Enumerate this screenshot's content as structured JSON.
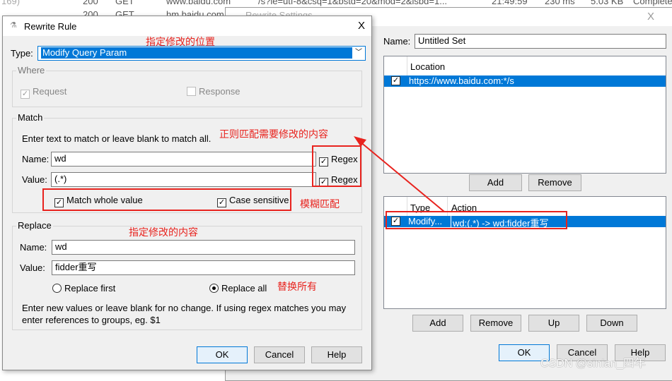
{
  "background": {
    "left_text": "169)",
    "rows": [
      {
        "status": "200",
        "method": "GET",
        "host": "www.baidu.com",
        "url": "/s?ie=utf-8&csq=1&bstd=20&mod=2&isbd=1...",
        "time": "21:49:59",
        "duration": "230 ms",
        "size": "5.03 KB",
        "state": "Complete"
      },
      {
        "status": "200",
        "method": "GET",
        "host": "hm.baidu.com"
      }
    ]
  },
  "settings": {
    "title": "Rewrite Settings",
    "close": "X",
    "name_label": "Name:",
    "name_value": "Untitled Set",
    "location_header": "Location",
    "location_row": "https://www.baidu.com:*/s",
    "add": "Add",
    "remove": "Remove",
    "type_header": "Type",
    "action_header": "Action",
    "rule_type": "Modify...",
    "rule_action": "wd:(.*) -> wd:fidder重写",
    "add2": "Add",
    "remove2": "Remove",
    "up": "Up",
    "down": "Down",
    "ok": "OK",
    "cancel": "Cancel",
    "help": "Help"
  },
  "rule": {
    "title": "Rewrite Rule",
    "close": "X",
    "type_label": "Type:",
    "type_value": "Modify Query Param",
    "where": "Where",
    "request": "Request",
    "response": "Response",
    "match": "Match",
    "match_hint": "Enter text to match or leave blank to match all.",
    "name_label": "Name:",
    "name_value": "wd",
    "value_label": "Value:",
    "value_value": "(.*)",
    "regex": "Regex",
    "match_whole": "Match whole value",
    "case_sensitive": "Case sensitive",
    "replace": "Replace",
    "r_name_value": "wd",
    "r_value_value": "fidder重写",
    "replace_first": "Replace first",
    "replace_all": "Replace all",
    "replace_hint": "Enter new values or leave blank for no change. If using regex matches you may enter references to groups, eg. $1",
    "ok": "OK",
    "cancel": "Cancel",
    "help": "Help"
  },
  "annotations": {
    "position": "指定修改的位置",
    "regex_content": "正则匹配需要修改的内容",
    "fuzzy": "模糊匹配",
    "content": "指定修改的内容",
    "replace_all": "替换所有"
  },
  "watermark": "CSDN @sinian_四年",
  "colors": {
    "accent": "#0078d7",
    "annotation": "#e8231e"
  }
}
